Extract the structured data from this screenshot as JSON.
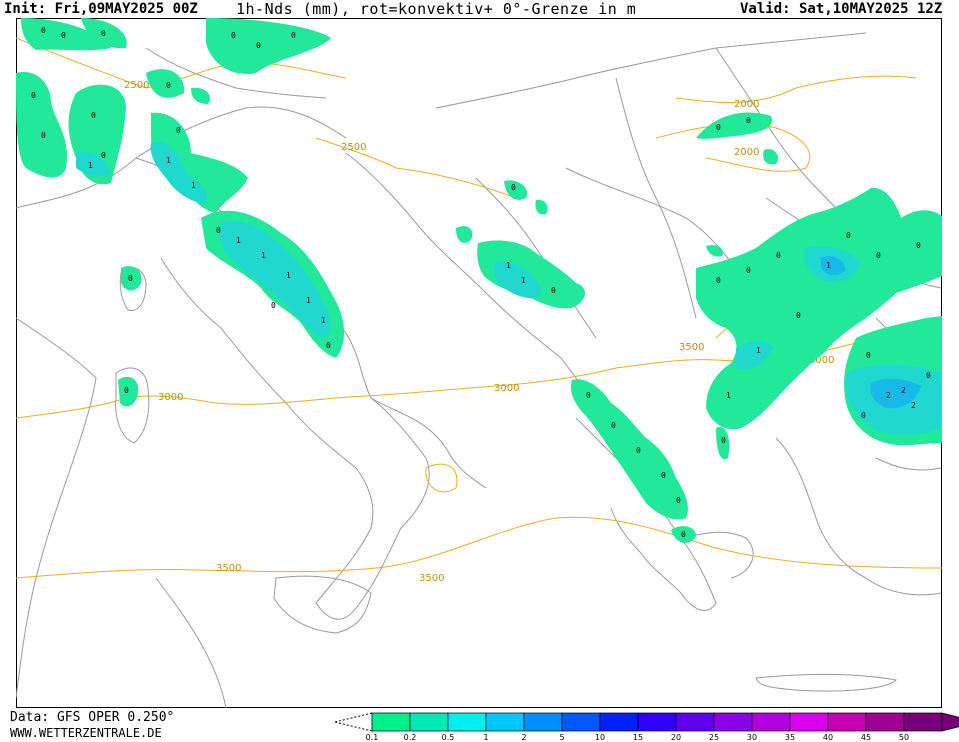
{
  "header": {
    "init": "Init: Fri,09MAY2025 00Z",
    "title": "1h-Nds (mm), rot=konvektiv+ 0°-Grenze in m",
    "valid": "Valid: Sat,10MAY2025 12Z"
  },
  "footer": {
    "data_source": "Data: GFS OPER 0.250°",
    "website": "WWW.WETTERZENTRALE.DE"
  },
  "map": {
    "contour_labels": [
      "2500",
      "2500",
      "2000",
      "2000",
      "3000",
      "3000",
      "3000",
      "3500",
      "3500",
      "3500"
    ],
    "cell_symbols": [
      "0",
      "1",
      "2"
    ],
    "colors": {
      "coast": "#9a9a9a",
      "contour": "#e8b020",
      "precip_light": "#22e89a",
      "precip_mid": "#20d8d0",
      "precip_heavy": "#18b8e8"
    }
  },
  "legend": {
    "ticks": [
      "0.1",
      "0.2",
      "0.5",
      "1",
      "2",
      "5",
      "10",
      "15",
      "20",
      "25",
      "30",
      "35",
      "40",
      "45",
      "50"
    ],
    "colors": [
      "#00f08c",
      "#00e8b4",
      "#00f0f0",
      "#00c8ff",
      "#0090ff",
      "#0058ff",
      "#0020ff",
      "#3000ff",
      "#6000f0",
      "#8a00e8",
      "#b400e0",
      "#dc00f0",
      "#c800b4",
      "#a00090",
      "#780078"
    ]
  }
}
